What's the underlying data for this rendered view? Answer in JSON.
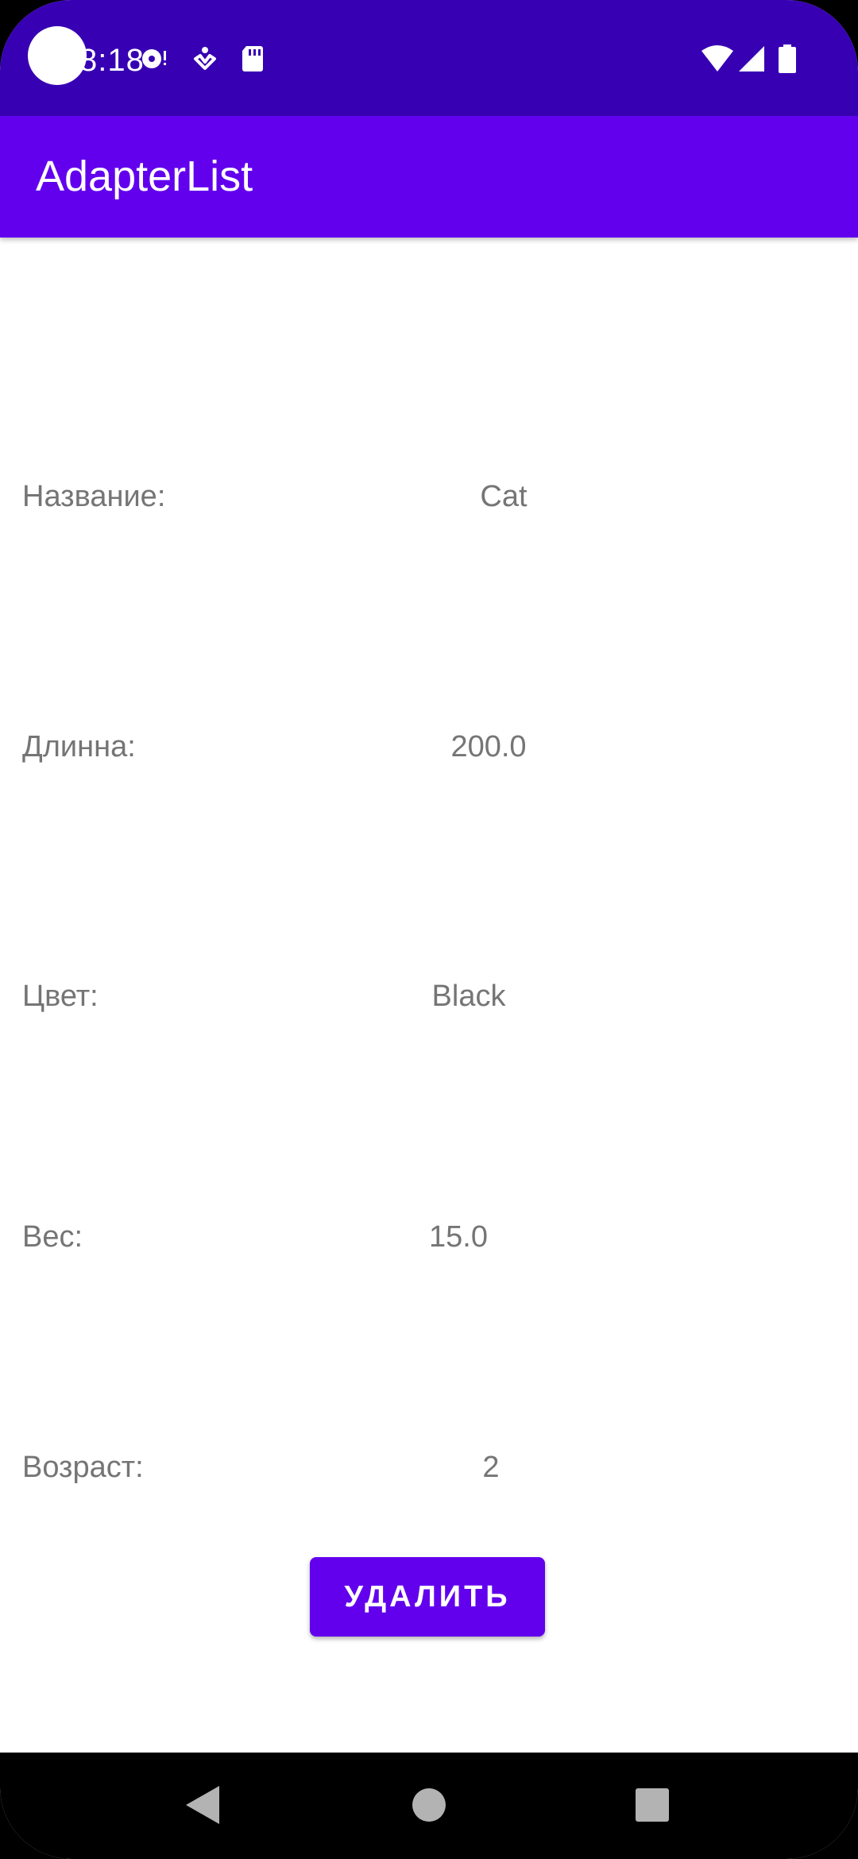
{
  "status_bar": {
    "time": "8:18",
    "icons": [
      "camera-cutout",
      "media-notification-icon",
      "accessibility-notification-icon",
      "sd-card-icon",
      "wifi-icon",
      "cell-signal-icon",
      "battery-icon"
    ]
  },
  "app_bar": {
    "title": "AdapterList"
  },
  "fields": [
    {
      "label": "Название:",
      "value": "Cat"
    },
    {
      "label": "Длинна:",
      "value": "200.0"
    },
    {
      "label": "Цвет:",
      "value": "Black"
    },
    {
      "label": "Вес:",
      "value": "15.0"
    },
    {
      "label": "Возраст:",
      "value": "2"
    }
  ],
  "actions": {
    "delete_label": "УДАЛИТЬ"
  },
  "nav_bar": {
    "icons": [
      "back-icon",
      "home-icon",
      "recents-icon"
    ]
  },
  "colors": {
    "status_bar": "#3700b3",
    "primary": "#6200ee",
    "text_secondary": "#757575",
    "background": "#ffffff"
  }
}
